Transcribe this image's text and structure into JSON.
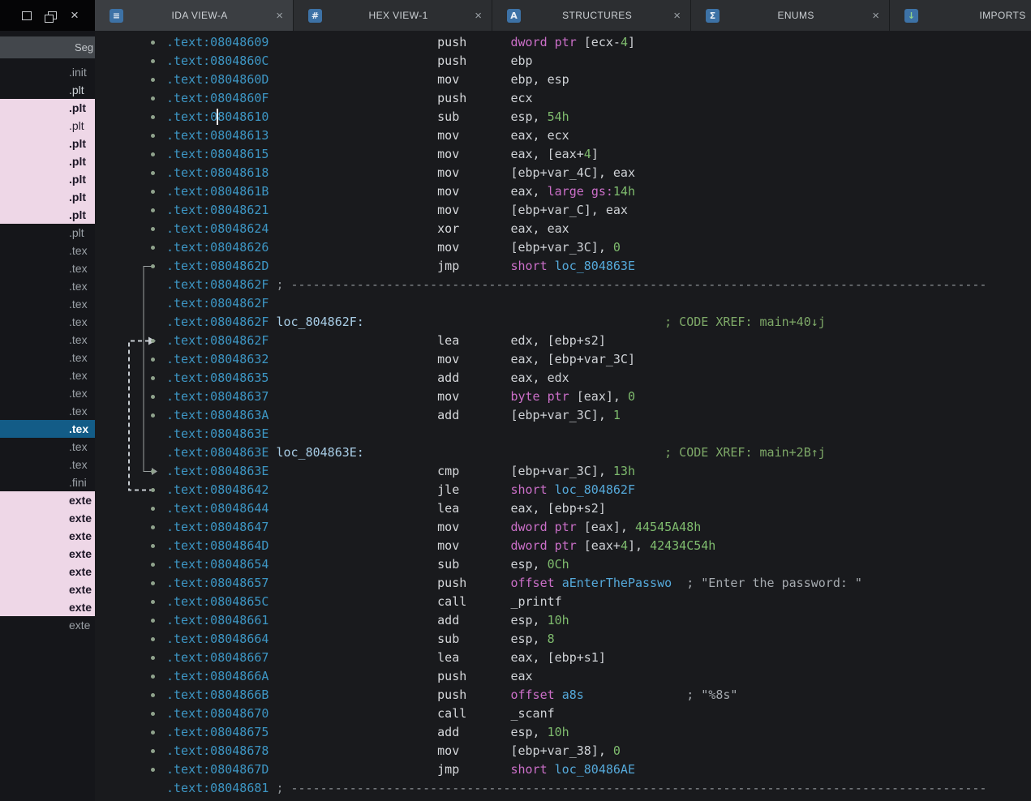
{
  "icons": {
    "close": "×",
    "window_controls": [
      "float-icon",
      "restore-icon",
      "close-icon"
    ]
  },
  "colors": {
    "address_blue": "#3d96c4",
    "keyword_magenta": "#cb6fc8",
    "number_green": "#7fbc6e",
    "name_blue": "#55a9da",
    "xref_green": "#7ea968",
    "selection_blue": "#135c87",
    "segment_highlight_pink": "#eed7e7"
  },
  "tabs": [
    {
      "label": "IDA VIEW-A",
      "icon": "ida-view-icon",
      "glyph": "≡",
      "active": true,
      "closable": true
    },
    {
      "label": "HEX VIEW-1",
      "icon": "hex-view-icon",
      "glyph": "#",
      "active": false,
      "closable": true
    },
    {
      "label": "STRUCTURES",
      "icon": "structures-icon",
      "glyph": "A",
      "active": false,
      "closable": true
    },
    {
      "label": "ENUMS",
      "icon": "enums-icon",
      "glyph": "Σ",
      "active": false,
      "closable": true
    },
    {
      "label": "IMPORTS",
      "icon": "imports-icon",
      "glyph": "↓",
      "active": false,
      "closable": false
    }
  ],
  "segments_panel": {
    "title": "Seg",
    "items": [
      {
        "label": ".init",
        "style": "muted"
      },
      {
        "label": ".plt",
        "style": "light"
      },
      {
        "label": ".plt",
        "style": "pink-bold"
      },
      {
        "label": ".plt",
        "style": "pink"
      },
      {
        "label": ".plt",
        "style": "pink-bold"
      },
      {
        "label": ".plt",
        "style": "pink-bold"
      },
      {
        "label": ".plt",
        "style": "pink-bold"
      },
      {
        "label": ".plt",
        "style": "pink-bold"
      },
      {
        "label": ".plt",
        "style": "pink-bold"
      },
      {
        "label": ".plt",
        "style": "muted"
      },
      {
        "label": ".tex",
        "style": "muted"
      },
      {
        "label": ".tex",
        "style": "muted"
      },
      {
        "label": ".tex",
        "style": "muted"
      },
      {
        "label": ".tex",
        "style": "muted"
      },
      {
        "label": ".tex",
        "style": "muted"
      },
      {
        "label": ".tex",
        "style": "muted"
      },
      {
        "label": ".tex",
        "style": "muted"
      },
      {
        "label": ".tex",
        "style": "muted"
      },
      {
        "label": ".tex",
        "style": "muted"
      },
      {
        "label": ".tex",
        "style": "muted"
      },
      {
        "label": ".tex",
        "style": "selected"
      },
      {
        "label": ".tex",
        "style": "muted"
      },
      {
        "label": ".tex",
        "style": "muted"
      },
      {
        "label": ".fini",
        "style": "muted"
      },
      {
        "label": "exte",
        "style": "pink-bold"
      },
      {
        "label": "exte",
        "style": "pink-bold"
      },
      {
        "label": "exte",
        "style": "pink-bold"
      },
      {
        "label": "exte",
        "style": "pink-bold"
      },
      {
        "label": "exte",
        "style": "pink-bold"
      },
      {
        "label": "exte",
        "style": "pink-bold"
      },
      {
        "label": "exte",
        "style": "pink-bold"
      },
      {
        "label": "exte",
        "style": "muted"
      }
    ]
  },
  "disassembly": {
    "lines": [
      {
        "a": ".text:08048609",
        "m": "push",
        "o": "dword ptr [ecx-4]"
      },
      {
        "a": ".text:0804860C",
        "m": "push",
        "o": "ebp"
      },
      {
        "a": ".text:0804860D",
        "m": "mov",
        "o": "ebp, esp"
      },
      {
        "a": ".text:0804860F",
        "m": "push",
        "o": "ecx"
      },
      {
        "a": ".text:08048610",
        "m": "sub",
        "o": "esp, 54h"
      },
      {
        "a": ".text:08048613",
        "m": "mov",
        "o": "eax, ecx"
      },
      {
        "a": ".text:08048615",
        "m": "mov",
        "o": "eax, [eax+4]"
      },
      {
        "a": ".text:08048618",
        "m": "mov",
        "o": "[ebp+var_4C], eax"
      },
      {
        "a": ".text:0804861B",
        "m": "mov",
        "o": "eax, large gs:14h"
      },
      {
        "a": ".text:08048621",
        "m": "mov",
        "o": "[ebp+var_C], eax"
      },
      {
        "a": ".text:08048624",
        "m": "xor",
        "o": "eax, eax"
      },
      {
        "a": ".text:08048626",
        "m": "mov",
        "o": "[ebp+var_3C], 0"
      },
      {
        "a": ".text:0804862D",
        "m": "jmp",
        "o": "short loc_804863E"
      },
      {
        "a": ".text:0804862F",
        "sep": true
      },
      {
        "a": ".text:0804862F"
      },
      {
        "a": ".text:0804862F",
        "label": "loc_804862F:",
        "cmt": "; CODE XREF: main+40↓j"
      },
      {
        "a": ".text:0804862F",
        "m": "lea",
        "o": "edx, [ebp+s2]"
      },
      {
        "a": ".text:08048632",
        "m": "mov",
        "o": "eax, [ebp+var_3C]"
      },
      {
        "a": ".text:08048635",
        "m": "add",
        "o": "eax, edx"
      },
      {
        "a": ".text:08048637",
        "m": "mov",
        "o": "byte ptr [eax], 0"
      },
      {
        "a": ".text:0804863A",
        "m": "add",
        "o": "[ebp+var_3C], 1"
      },
      {
        "a": ".text:0804863E"
      },
      {
        "a": ".text:0804863E",
        "label": "loc_804863E:",
        "cmt": "; CODE XREF: main+2B↑j"
      },
      {
        "a": ".text:0804863E",
        "m": "cmp",
        "o": "[ebp+var_3C], 13h"
      },
      {
        "a": ".text:08048642",
        "m": "jle",
        "o": "short loc_804862F"
      },
      {
        "a": ".text:08048644",
        "m": "lea",
        "o": "eax, [ebp+s2]"
      },
      {
        "a": ".text:08048647",
        "m": "mov",
        "o": "dword ptr [eax], 44545A48h"
      },
      {
        "a": ".text:0804864D",
        "m": "mov",
        "o": "dword ptr [eax+4], 42434C54h"
      },
      {
        "a": ".text:08048654",
        "m": "sub",
        "o": "esp, 0Ch"
      },
      {
        "a": ".text:08048657",
        "m": "push",
        "o": "offset aEnterThePasswo",
        "cmt": "; \"Enter the password: \""
      },
      {
        "a": ".text:0804865C",
        "m": "call",
        "o": "_printf"
      },
      {
        "a": ".text:08048661",
        "m": "add",
        "o": "esp, 10h"
      },
      {
        "a": ".text:08048664",
        "m": "sub",
        "o": "esp, 8"
      },
      {
        "a": ".text:08048667",
        "m": "lea",
        "o": "eax, [ebp+s1]"
      },
      {
        "a": ".text:0804866A",
        "m": "push",
        "o": "eax"
      },
      {
        "a": ".text:0804866B",
        "m": "push",
        "o": "offset a8s",
        "cmt": "; \"%8s\""
      },
      {
        "a": ".text:08048670",
        "m": "call",
        "o": "_scanf"
      },
      {
        "a": ".text:08048675",
        "m": "add",
        "o": "esp, 10h"
      },
      {
        "a": ".text:08048678",
        "m": "mov",
        "o": "[ebp+var_38], 0"
      },
      {
        "a": ".text:0804867D",
        "m": "jmp",
        "o": "short loc_80486AE"
      },
      {
        "a": ".text:08048681",
        "sep": true
      }
    ]
  }
}
